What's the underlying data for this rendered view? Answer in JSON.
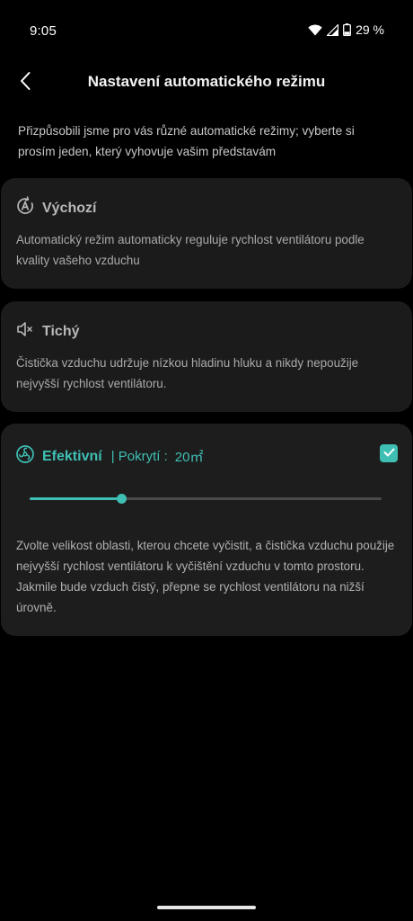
{
  "status_bar": {
    "time": "9:05",
    "battery_percent": "29 %",
    "icons": [
      "wifi-icon",
      "signal-icon",
      "battery-icon"
    ]
  },
  "app_bar": {
    "title": "Nastavení automatického režimu",
    "back_icon": "chevron-left-icon"
  },
  "intro": "Přizpůsobili jsme pro vás různé automatické režimy; vyberte si prosím jeden, který vyhovuje vašim představám",
  "modes": {
    "default": {
      "title": "Výchozí",
      "icon": "auto-mode-icon",
      "description": "Automatický režim automaticky reguluje rychlost ventilátoru podle kvality vašeho vzduchu"
    },
    "quiet": {
      "title": "Tichý",
      "icon": "speaker-mute-icon",
      "description": "Čistička vzduchu udržuje nízkou hladinu hluku a nikdy nepoužije nejvyšší rychlost ventilátoru."
    },
    "efficient": {
      "title": "Efektivní",
      "icon": "fan-icon",
      "coverage_label": "| Pokrytí :",
      "coverage_value": "20㎡",
      "selected": true,
      "slider_fraction": 0.26,
      "description": "Zvolte velikost oblasti, kterou chcete vyčistit, a čistička vzduchu použije nejvyšší rychlost ventilátoru k vyčištění vzduchu v tomto prostoru. Jakmile bude vzduch čistý, přepne se rychlost ventilátoru na nižší úrovně."
    }
  },
  "colors": {
    "accent": "#3fbfb4",
    "background": "#000000",
    "card": "#1b1b1b"
  }
}
